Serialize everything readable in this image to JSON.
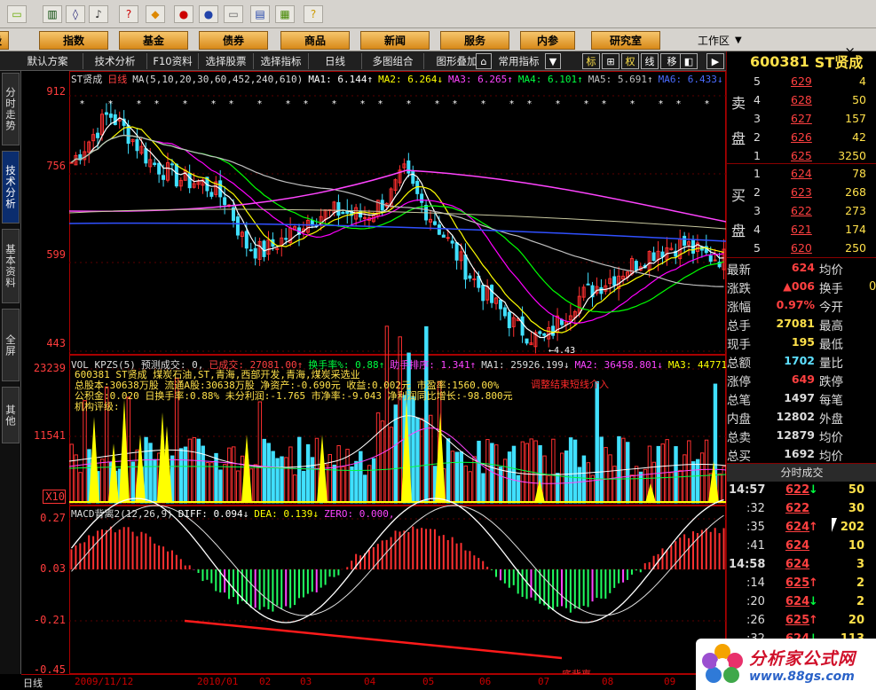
{
  "toolbar_icons": [
    {
      "name": "connect-icon",
      "glyph": "▭"
    },
    {
      "name": "chart-icon",
      "glyph": "▥"
    },
    {
      "name": "find-icon",
      "glyph": "◊"
    },
    {
      "name": "alarm-icon",
      "glyph": "♪"
    },
    {
      "name": "quote-icon",
      "glyph": "?"
    },
    {
      "name": "diamond-icon",
      "glyph": "◆"
    },
    {
      "name": "bubble-icon",
      "glyph": "●"
    },
    {
      "name": "info-icon",
      "glyph": "●"
    },
    {
      "name": "print-icon",
      "glyph": "▭"
    },
    {
      "name": "window-icon",
      "glyph": "▤"
    },
    {
      "name": "books-icon",
      "glyph": "▦"
    },
    {
      "name": "help-pointer-icon",
      "glyph": "?"
    }
  ],
  "menu": [
    "股",
    "指数",
    "基金",
    "债券",
    "商品",
    "新闻",
    "服务",
    "内参",
    "研究室"
  ],
  "workspace": {
    "label": "工作区",
    "arrow": "▼",
    "close": "×"
  },
  "toolbar": {
    "buttons": [
      "默认方案",
      "技术分析",
      "F10资料",
      "选择股票",
      "选择指标",
      "日线",
      "多图组合",
      "图形叠加",
      "常用指标"
    ],
    "right_buttons": [
      "标",
      "⊞",
      "权",
      "线",
      "移",
      "◧",
      "▶"
    ]
  },
  "side_tabs": [
    "分时走势",
    "技术分析",
    "基本资料",
    "全屏",
    "其他"
  ],
  "y_axis": {
    "price": [
      "912",
      "756",
      "599",
      "443"
    ],
    "volume": [
      "23239",
      "11541",
      "X10"
    ],
    "macd": [
      "0.27",
      "0.03",
      "-0.21",
      "-0.45"
    ]
  },
  "price_chart": {
    "header": [
      "ST贤成",
      "日线",
      "MA(5,10,20,30,60,452,240,610)",
      "MA1: 6.144↑",
      "MA2: 6.264↓",
      "MA3: 6.265↑",
      "MA4: 6.101↑",
      "MA5: 5.691↑",
      "MA6: 6.433↓",
      "MA7:"
    ],
    "colors": {
      "price": "#ffffff",
      "ma1": "#ffffff",
      "ma2": "#ffff00",
      "ma3": "#ff00ff",
      "ma4": "#00ff00",
      "ma5": "#c0c0c0",
      "ma6": "#3050ff",
      "ma7": "#ff44ff"
    },
    "high_label": "9.1",
    "low_label": "4.43",
    "ylim": [
      443,
      912
    ]
  },
  "volume_panel": {
    "header": [
      "VOL KPZS(5)",
      "预测成交: 0,",
      "已成交: 27081.00↑",
      "换手率%: 0.88↑",
      "助手排序: 1.341↑",
      "MA1: 25926.199↓",
      "MA2: 36458.801↓",
      "MA3: 44771."
    ],
    "info_lines": [
      "600381 ST贤成  煤炭石油,ST,青海,西部开发,青海,煤炭采选业",
      "总股本:30638万股  流通A股:30638万股    净资产:-0.690元  收益:0.002元   市盈率:1560.00%",
      "公积金:0.020  日换手率:0.88%  未分利润:-1.765  市净率:-9.043  净利润同比增长:-98.800元",
      "机构评级:"
    ],
    "signal_text": "调整结束短线介入"
  },
  "macd_panel": {
    "header": [
      "MACD背离2(12,26,9)",
      "DIFF: 0.094↓",
      "DEA: 0.139↓",
      "ZERO: 0.000,"
    ],
    "annotation": "底背离"
  },
  "date_axis": {
    "period_label": "日线",
    "dates": [
      "2009/11/12",
      "2010/01",
      "02",
      "03",
      "04",
      "05",
      "06",
      "07",
      "08",
      "09"
    ]
  },
  "quote": {
    "code": "600381",
    "name": "ST贤成",
    "sell_label": [
      "卖",
      "盘"
    ],
    "buy_label": [
      "买",
      "盘"
    ],
    "sell": [
      {
        "n": "5",
        "price": "629",
        "vol": "4"
      },
      {
        "n": "4",
        "price": "628",
        "vol": "50"
      },
      {
        "n": "3",
        "price": "627",
        "vol": "157"
      },
      {
        "n": "2",
        "price": "626",
        "vol": "42"
      },
      {
        "n": "1",
        "price": "625",
        "vol": "3250"
      }
    ],
    "buy": [
      {
        "n": "1",
        "price": "624",
        "vol": "78"
      },
      {
        "n": "2",
        "price": "623",
        "vol": "268"
      },
      {
        "n": "3",
        "price": "622",
        "vol": "273"
      },
      {
        "n": "4",
        "price": "621",
        "vol": "174"
      },
      {
        "n": "5",
        "price": "620",
        "vol": "250"
      }
    ],
    "stats": [
      {
        "k": "最新",
        "v": "624",
        "v_color": "#ff4040",
        "k2": "均价"
      },
      {
        "k": "涨跌",
        "v": "▲006",
        "v_color": "#ff4040",
        "k2": "换手"
      },
      {
        "k": "涨幅",
        "v": "0.97%",
        "v_color": "#ff4040",
        "k2": "今开"
      },
      {
        "k": "总手",
        "v": "27081",
        "v_color": "#ffe14a",
        "k2": "最高"
      },
      {
        "k": "现手",
        "v": "195",
        "v_color": "#ffe14a",
        "k2": "最低"
      },
      {
        "k": "总额",
        "v": "1702",
        "v_color": "#5ee0ff",
        "k2": "量比"
      },
      {
        "k": "涨停",
        "v": "649",
        "v_color": "#ff4040",
        "k2": "跌停"
      },
      {
        "k": "总笔",
        "v": "1497",
        "v_color": "#ddd",
        "k2": "每笔"
      },
      {
        "k": "内盘",
        "v": "12802",
        "v_color": "#ddd",
        "k2": "外盘"
      },
      {
        "k": "总卖",
        "v": "12879",
        "v_color": "#ddd",
        "k2": "均价"
      },
      {
        "k": "总买",
        "v": "1692",
        "v_color": "#ddd",
        "k2": "均价"
      }
    ],
    "stat_extra": "0",
    "ticks_title": "分时成交",
    "ticks": [
      {
        "t": "14:57",
        "p": "622",
        "arrow": "↓",
        "v": "50",
        "arrow_color": "#00ff40",
        "bold_time": true
      },
      {
        "t": ":32",
        "p": "622",
        "arrow": "",
        "v": "30",
        "arrow_color": "#ffffff",
        "bold_time": false
      },
      {
        "t": ":35",
        "p": "624",
        "arrow": "↑",
        "v": "202",
        "arrow_color": "#ff4040",
        "bold_time": false
      },
      {
        "t": ":41",
        "p": "624",
        "arrow": "",
        "v": "10",
        "arrow_color": "#ffffff",
        "bold_time": false
      },
      {
        "t": "14:58",
        "p": "624",
        "arrow": "",
        "v": "3",
        "arrow_color": "#ffffff",
        "bold_time": true
      },
      {
        "t": ":14",
        "p": "625",
        "arrow": "↑",
        "v": "2",
        "arrow_color": "#ff4040",
        "bold_time": false
      },
      {
        "t": ":20",
        "p": "624",
        "arrow": "↓",
        "v": "2",
        "arrow_color": "#00ff40",
        "bold_time": false
      },
      {
        "t": ":26",
        "p": "625",
        "arrow": "↑",
        "v": "20",
        "arrow_color": "#ff4040",
        "bold_time": false
      },
      {
        "t": ":32",
        "p": "624",
        "arrow": "↓",
        "v": "113",
        "arrow_color": "#00ff40",
        "bold_time": false
      }
    ]
  },
  "watermark": {
    "title": "分析家公式网",
    "url": "www.88gs.com"
  }
}
